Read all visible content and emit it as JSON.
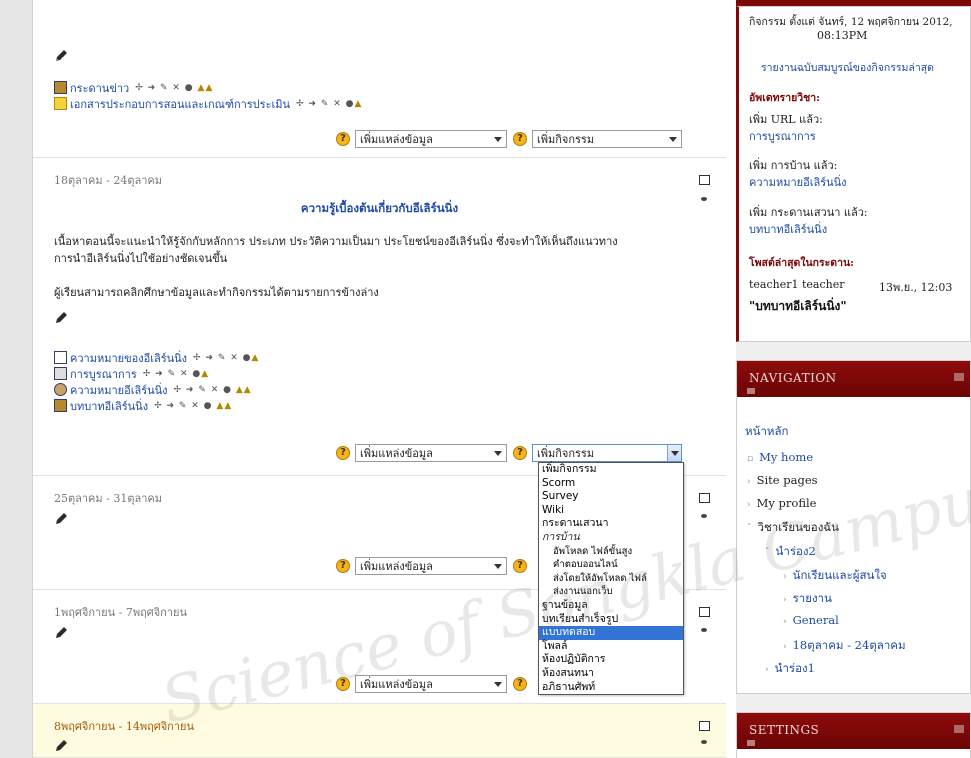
{
  "watermark": "Science of Songkla Campus",
  "adders": {
    "resource": "เพิ่มแหล่งข้อมูล",
    "activity": "เพิ่มกิจกรรม",
    "help": "?"
  },
  "top_section": {
    "activities": [
      {
        "label": "กระดานข่าว",
        "icon": "forum-icon"
      },
      {
        "label": "เอกสารประกอบการสอนและเกณฑ์การประเมิน",
        "icon": "folder-icon"
      }
    ]
  },
  "section1": {
    "date": "18ตุลาคม - 24ตุลาคม",
    "title": "ความรู้เบื้องต้นเกี่ยวกับอีเลิร์นนิ่ง",
    "summary_1": "เนื้อหาตอนนี้จะแนะนำให้รู้จักกับหลักการ ประเภท ประวัติความเป็นมา ประโยชน์ของอีเลิร์นนิ่ง ซึ่งจะทำให้เห็นถึงแนวทาง",
    "summary_2": "การนำอีเลิร์นนิ่งไปใช้อย่างชัดเจนขึ้น",
    "summary_3": "ผู้เรียนสามารถคลิกศึกษาข้อมูลและทำกิจกรรมได้ตามรายการข้างล่าง",
    "activities": [
      {
        "label": "ความหมายของอีเลิร์นนิ่ง",
        "icon": "file-icon"
      },
      {
        "label": "การบูรณาการ",
        "icon": "file-icon"
      },
      {
        "label": "ความหมายอีเลิร์นนิ่ง",
        "icon": "assignment-icon"
      },
      {
        "label": "บทบาทอีเลิร์นนิ่ง",
        "icon": "forum-icon"
      }
    ]
  },
  "section2": {
    "date": "25ตุลาคม - 31ตุลาคม"
  },
  "section3": {
    "date": "1พฤศจิกายน - 7พฤศจิกายน"
  },
  "section4": {
    "date": "8พฤศจิกายน - 14พฤศจิกายน"
  },
  "dropdown": {
    "items": [
      {
        "label": "เพิ่มกิจกรรม",
        "kind": "plain"
      },
      {
        "label": "Scorm",
        "kind": "plain"
      },
      {
        "label": "Survey",
        "kind": "plain"
      },
      {
        "label": "Wiki",
        "kind": "plain"
      },
      {
        "label": "กระดานเสวนา",
        "kind": "plain"
      },
      {
        "label": "การบ้าน",
        "kind": "group"
      },
      {
        "label": "อัพโหลด ไฟล์ขั้นสูง",
        "kind": "child"
      },
      {
        "label": "คำตอบออนไลน์",
        "kind": "child"
      },
      {
        "label": "ส่งโดยให้อัพโหลด ไฟล์",
        "kind": "child"
      },
      {
        "label": "ส่งงานนอกเว็บ",
        "kind": "child"
      },
      {
        "label": "ฐานข้อมูล",
        "kind": "plain"
      },
      {
        "label": "บทเรียนสำเร็จรูป",
        "kind": "plain"
      },
      {
        "label": "แบบทดสอบ",
        "kind": "selected"
      },
      {
        "label": "โพลล์",
        "kind": "plain"
      },
      {
        "label": "ห้องปฏิบัติการ",
        "kind": "plain"
      },
      {
        "label": "ห้องสนทนา",
        "kind": "plain"
      },
      {
        "label": "อภิธานศัพท์",
        "kind": "plain"
      }
    ]
  },
  "recent": {
    "since_1": "กิจกรรม ตั้งแต่ จันทร์, 12 พฤศจิกายน 2012,",
    "since_2": "08:13PM",
    "full_report": "รายงานฉบับสมบูรณ์ของกิจกรรมล่าสุด",
    "course_updates_head": "อัพเดทรายวิชา:",
    "add_url": "เพิ่ม URL แล้ว:",
    "url_name": "การบูรณาการ",
    "add_assign": "เพิ่ม การบ้าน แล้ว:",
    "assign_name": "ความหมายอีเลิร์นนิ่ง",
    "add_forum": "เพิ่ม กระดานเสวนา แล้ว:",
    "forum_name": "บทบาทอีเลิร์นนิ่ง",
    "forum_posts_head": "โพสต์ล่าสุดในกระดาน:",
    "post_author": "teacher1 teacher",
    "post_time": "13พ.ย., 12:03",
    "post_title": "\"บทบาทอีเลิร์นนิ่ง\""
  },
  "navigation": {
    "title": "NAVIGATION",
    "home": "หน้าหลัก",
    "my_home": "My home",
    "site_pages": "Site pages",
    "my_profile": "My profile",
    "my_courses": "วิชาเรียนของฉัน",
    "course": "นำร่อง2",
    "participants": "นักเรียนและผู้สนใจ",
    "reports": "รายงาน",
    "general": "General",
    "week": "18ตุลาคม - 24ตุลาคม",
    "course2": "นำร่อง1"
  },
  "settings": {
    "title": "SETTINGS"
  }
}
